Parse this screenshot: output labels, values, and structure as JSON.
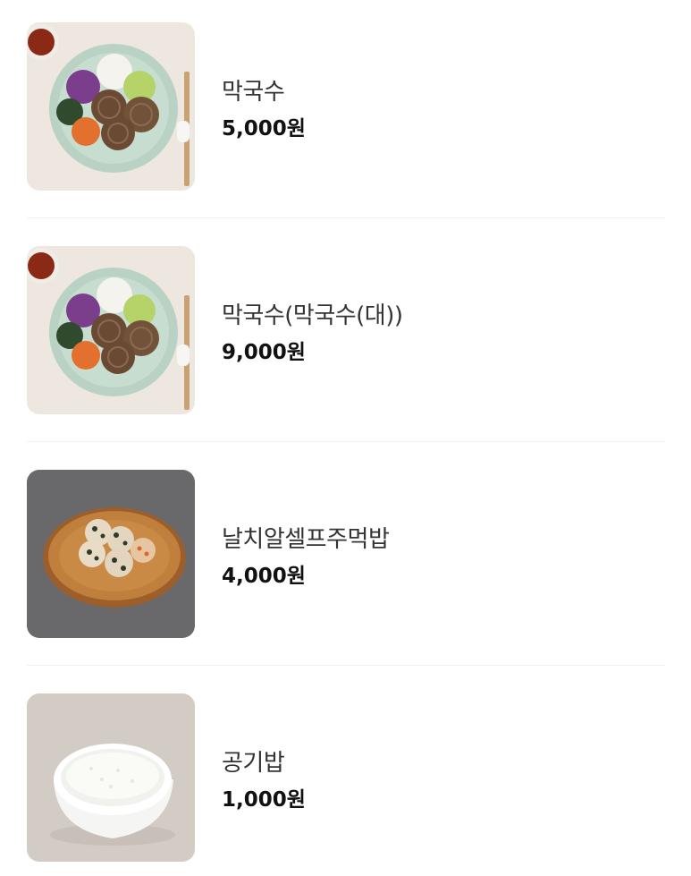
{
  "menu": {
    "items": [
      {
        "name": "막국수",
        "price": "5,000원",
        "image": "buckwheat-noodle-plate-image"
      },
      {
        "name": "막국수(막국수(대))",
        "price": "9,000원",
        "image": "buckwheat-noodle-plate-image"
      },
      {
        "name": "날치알셀프주먹밥",
        "price": "4,000원",
        "image": "rice-ball-plate-image"
      },
      {
        "name": "공기밥",
        "price": "1,000원",
        "image": "rice-bowl-image"
      }
    ]
  }
}
